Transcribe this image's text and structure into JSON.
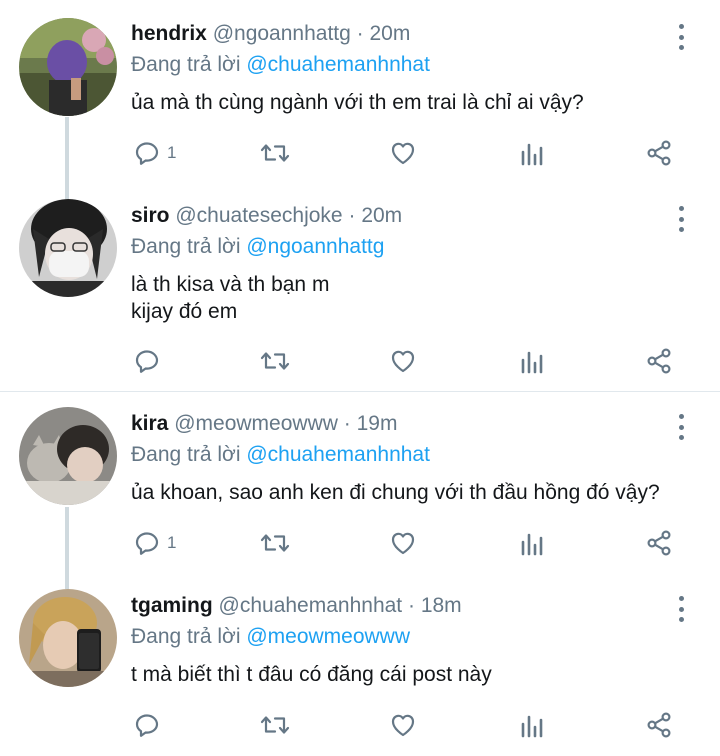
{
  "tweets": [
    {
      "name": "hendrix",
      "handle": "@ngoannhattg",
      "dot": "·",
      "time": "20m",
      "reply_prefix": "Đang trả lời",
      "reply_to": "@chuahemanhnhat",
      "body": [
        "ủa mà th cùng ngành với th em trai là chỉ ai vậy?"
      ],
      "reply_count": "1"
    },
    {
      "name": "siro",
      "handle": "@chuatesechjoke",
      "dot": "·",
      "time": "20m",
      "reply_prefix": "Đang trả lời",
      "reply_to": "@ngoannhattg",
      "body": [
        "là th kisa và th bạn m",
        "kijay đó em"
      ],
      "reply_count": ""
    },
    {
      "name": "kira",
      "handle": "@meowmeowww",
      "dot": "·",
      "time": "19m",
      "reply_prefix": "Đang trả lời",
      "reply_to": "@chuahemanhnhat",
      "body": [
        "ủa khoan, sao anh ken đi chung với th đầu hồng đó vậy?"
      ],
      "reply_count": "1"
    },
    {
      "name": "tgaming",
      "handle": "@chuahemanhnhat",
      "dot": "·",
      "time": "18m",
      "reply_prefix": "Đang trả lời",
      "reply_to": "@meowmeowww",
      "body": [
        "t mà biết thì t đâu có đăng cái post này"
      ],
      "reply_count": ""
    }
  ],
  "icons": {
    "reply": "reply-icon",
    "retweet": "retweet-icon",
    "like": "heart-icon",
    "stats": "stats-icon",
    "share": "share-icon",
    "more": "more-vertical-icon"
  },
  "colors": {
    "text": "#14171a",
    "secondary": "#657786",
    "mention": "#1da1f2",
    "thread_line": "#cfd9de",
    "separator": "#e1e8ed"
  }
}
